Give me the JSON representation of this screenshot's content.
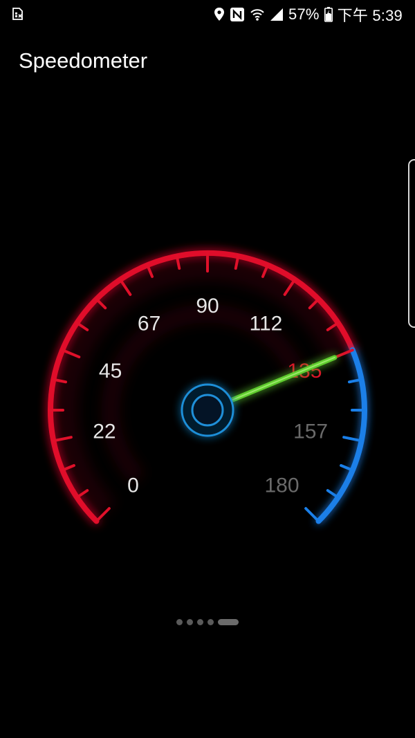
{
  "status_bar": {
    "left_icon": "sim-card-x-icon",
    "icons": [
      "location-pin-icon",
      "nfc-icon",
      "wifi-icon",
      "cell-signal-icon"
    ],
    "battery_percent": "57%",
    "battery_icon": "battery-charging-icon",
    "time": "下午 5:39"
  },
  "app": {
    "title": "Speedometer"
  },
  "speedometer": {
    "tick_labels": [
      "0",
      "22",
      "45",
      "67",
      "90",
      "112",
      "135",
      "157",
      "180"
    ],
    "min": 0,
    "max": 180,
    "reading": 135,
    "colors": {
      "arc_low": "#e0102a",
      "arc_high": "#1a7fe8",
      "needle": "#5fcc2e",
      "hub": "#1f8fd8",
      "label_active": "#e0102a",
      "label_normal": "#e6e6e6",
      "label_dim": "#6a6a6a"
    }
  },
  "pager": {
    "total": 5,
    "active_index": 4
  }
}
